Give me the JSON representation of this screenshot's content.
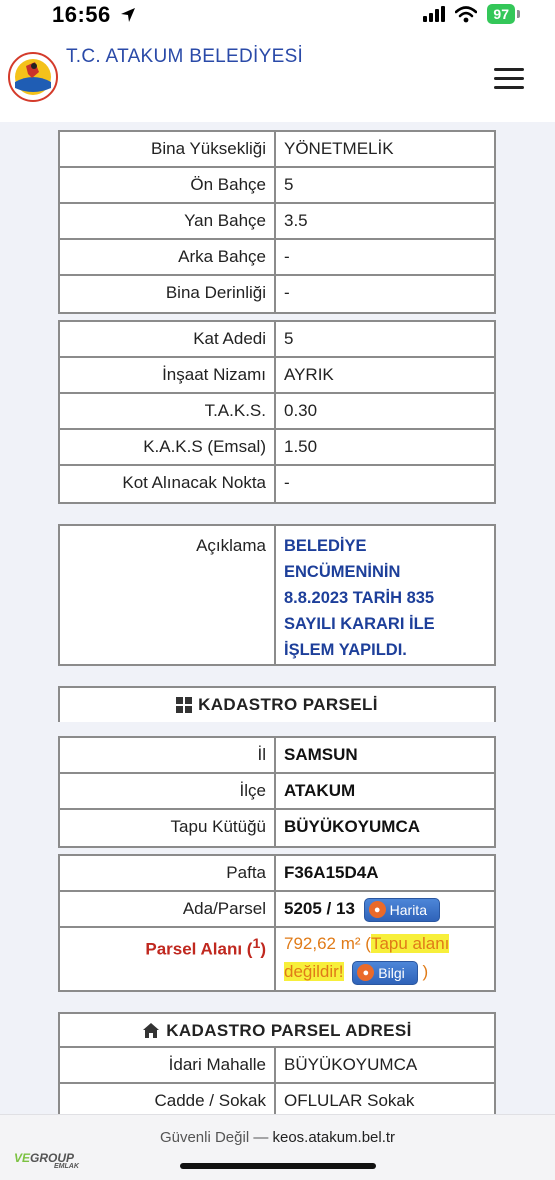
{
  "status": {
    "time": "16:56",
    "battery": "97"
  },
  "header": {
    "title": "T.C. ATAKUM BELEDİYESİ"
  },
  "panel1": [
    {
      "label": "Bina Yüksekliği",
      "value": "YÖNETMELİK"
    },
    {
      "label": "Ön Bahçe",
      "value": "5"
    },
    {
      "label": "Yan Bahçe",
      "value": "3.5"
    },
    {
      "label": "Arka Bahçe",
      "value": "-"
    },
    {
      "label": "Bina Derinliği",
      "value": "-"
    }
  ],
  "panel2": [
    {
      "label": "Kat Adedi",
      "value": "5"
    },
    {
      "label": "İnşaat Nizamı",
      "value": "AYRIK"
    },
    {
      "label": "T.A.K.S.",
      "value": "0.30"
    },
    {
      "label": "K.A.K.S (Emsal)",
      "value": "1.50"
    },
    {
      "label": "Kot Alınacak Nokta",
      "value": "-"
    }
  ],
  "aciklama": {
    "label": "Açıklama",
    "lines": [
      "BELEDİYE",
      "ENCÜMENİNİN",
      "8.8.2023 TARİH 835",
      "SAYILI KARARI İLE",
      "İŞLEM YAPILDI."
    ]
  },
  "kadastro": {
    "title": "KADASTRO PARSELİ",
    "panelA": [
      {
        "label": "İl",
        "value": "SAMSUN"
      },
      {
        "label": "İlçe",
        "value": "ATAKUM"
      },
      {
        "label": "Tapu Kütüğü",
        "value": "BÜYÜKOYUMCA"
      }
    ],
    "pafta_label": "Pafta",
    "pafta_value": "F36A15D4A",
    "ada_label": "Ada/Parsel",
    "ada_value": "5205 / 13",
    "harita_btn": "Harita",
    "alan_label": "Parsel Alanı (",
    "alan_sup": "1",
    "alan_label_end": ")",
    "alan_value": "792,62 m²",
    "alan_paren_open": " (",
    "alan_note_1": "Tapu alanı",
    "alan_note_2": "değildir!",
    "bilgi_btn": "Bilgi",
    "alan_paren_close": " )"
  },
  "adres": {
    "title": "KADASTRO PARSEL ADRESİ",
    "rows": [
      {
        "label": "İdari Mahalle",
        "value": "BÜYÜKOYUMCA"
      },
      {
        "label": "Cadde / Sokak",
        "value": "OFLULAR Sokak"
      }
    ]
  },
  "browser": {
    "prefix": "Güvenli Değil — ",
    "host": "keos.atakum.bel.tr"
  },
  "watermark": {
    "brand": "GROUP",
    "sub": "EMLAK"
  }
}
